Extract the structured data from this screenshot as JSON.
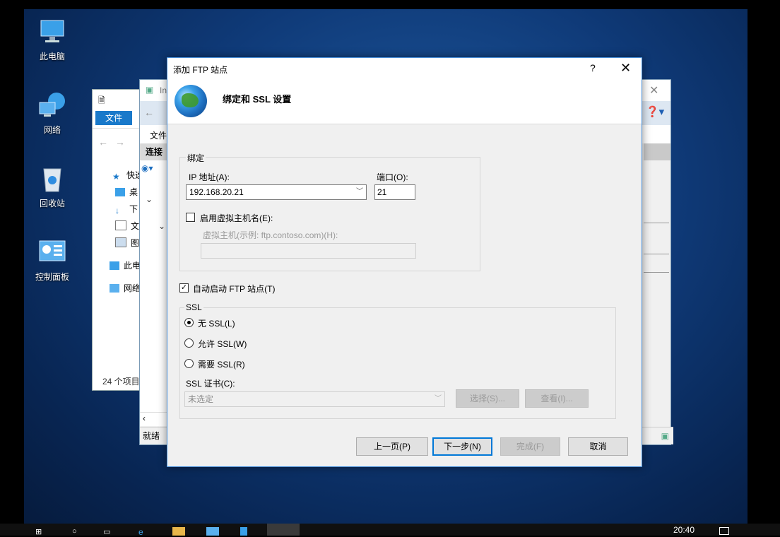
{
  "desktop": {
    "icons": [
      {
        "label": "此电脑",
        "icon": "computer-icon"
      },
      {
        "label": "网络",
        "icon": "network-icon"
      },
      {
        "label": "回收站",
        "icon": "recycle-bin-icon"
      },
      {
        "label": "控制面板",
        "icon": "control-panel-icon"
      }
    ]
  },
  "explorer": {
    "file_tab": "文件",
    "nav_items": [
      "快速",
      "桌",
      "下",
      "文",
      "图",
      "此电",
      "网络"
    ],
    "status": "24 个项目"
  },
  "iis": {
    "title_partial": "In",
    "menu_file": "文件",
    "connections": "连接",
    "status": "就绪"
  },
  "dialog": {
    "title": "添加 FTP 站点",
    "help": "?",
    "close": "✕",
    "heading": "绑定和 SSL 设置",
    "binding": {
      "group_label": "绑定",
      "ip_label": "IP 地址(A):",
      "ip_value": "192.168.20.21",
      "port_label": "端口(O):",
      "port_value": "21",
      "virtual_host_enable": "启用虚拟主机名(E):",
      "virtual_host_label": "虚拟主机(示例: ftp.contoso.com)(H):",
      "virtual_host_value": ""
    },
    "auto_start": "自动启动 FTP 站点(T)",
    "auto_start_checked": true,
    "ssl": {
      "group_label": "SSL",
      "options": [
        "无 SSL(L)",
        "允许 SSL(W)",
        "需要 SSL(R)"
      ],
      "selected": 0,
      "cert_label": "SSL 证书(C):",
      "cert_value": "未选定",
      "select_button": "选择(S)...",
      "view_button": "查看(I)..."
    },
    "buttons": {
      "prev": "上一页(P)",
      "next": "下一步(N)",
      "finish": "完成(F)",
      "cancel": "取消"
    }
  },
  "taskbar": {
    "clock": "20:40"
  }
}
